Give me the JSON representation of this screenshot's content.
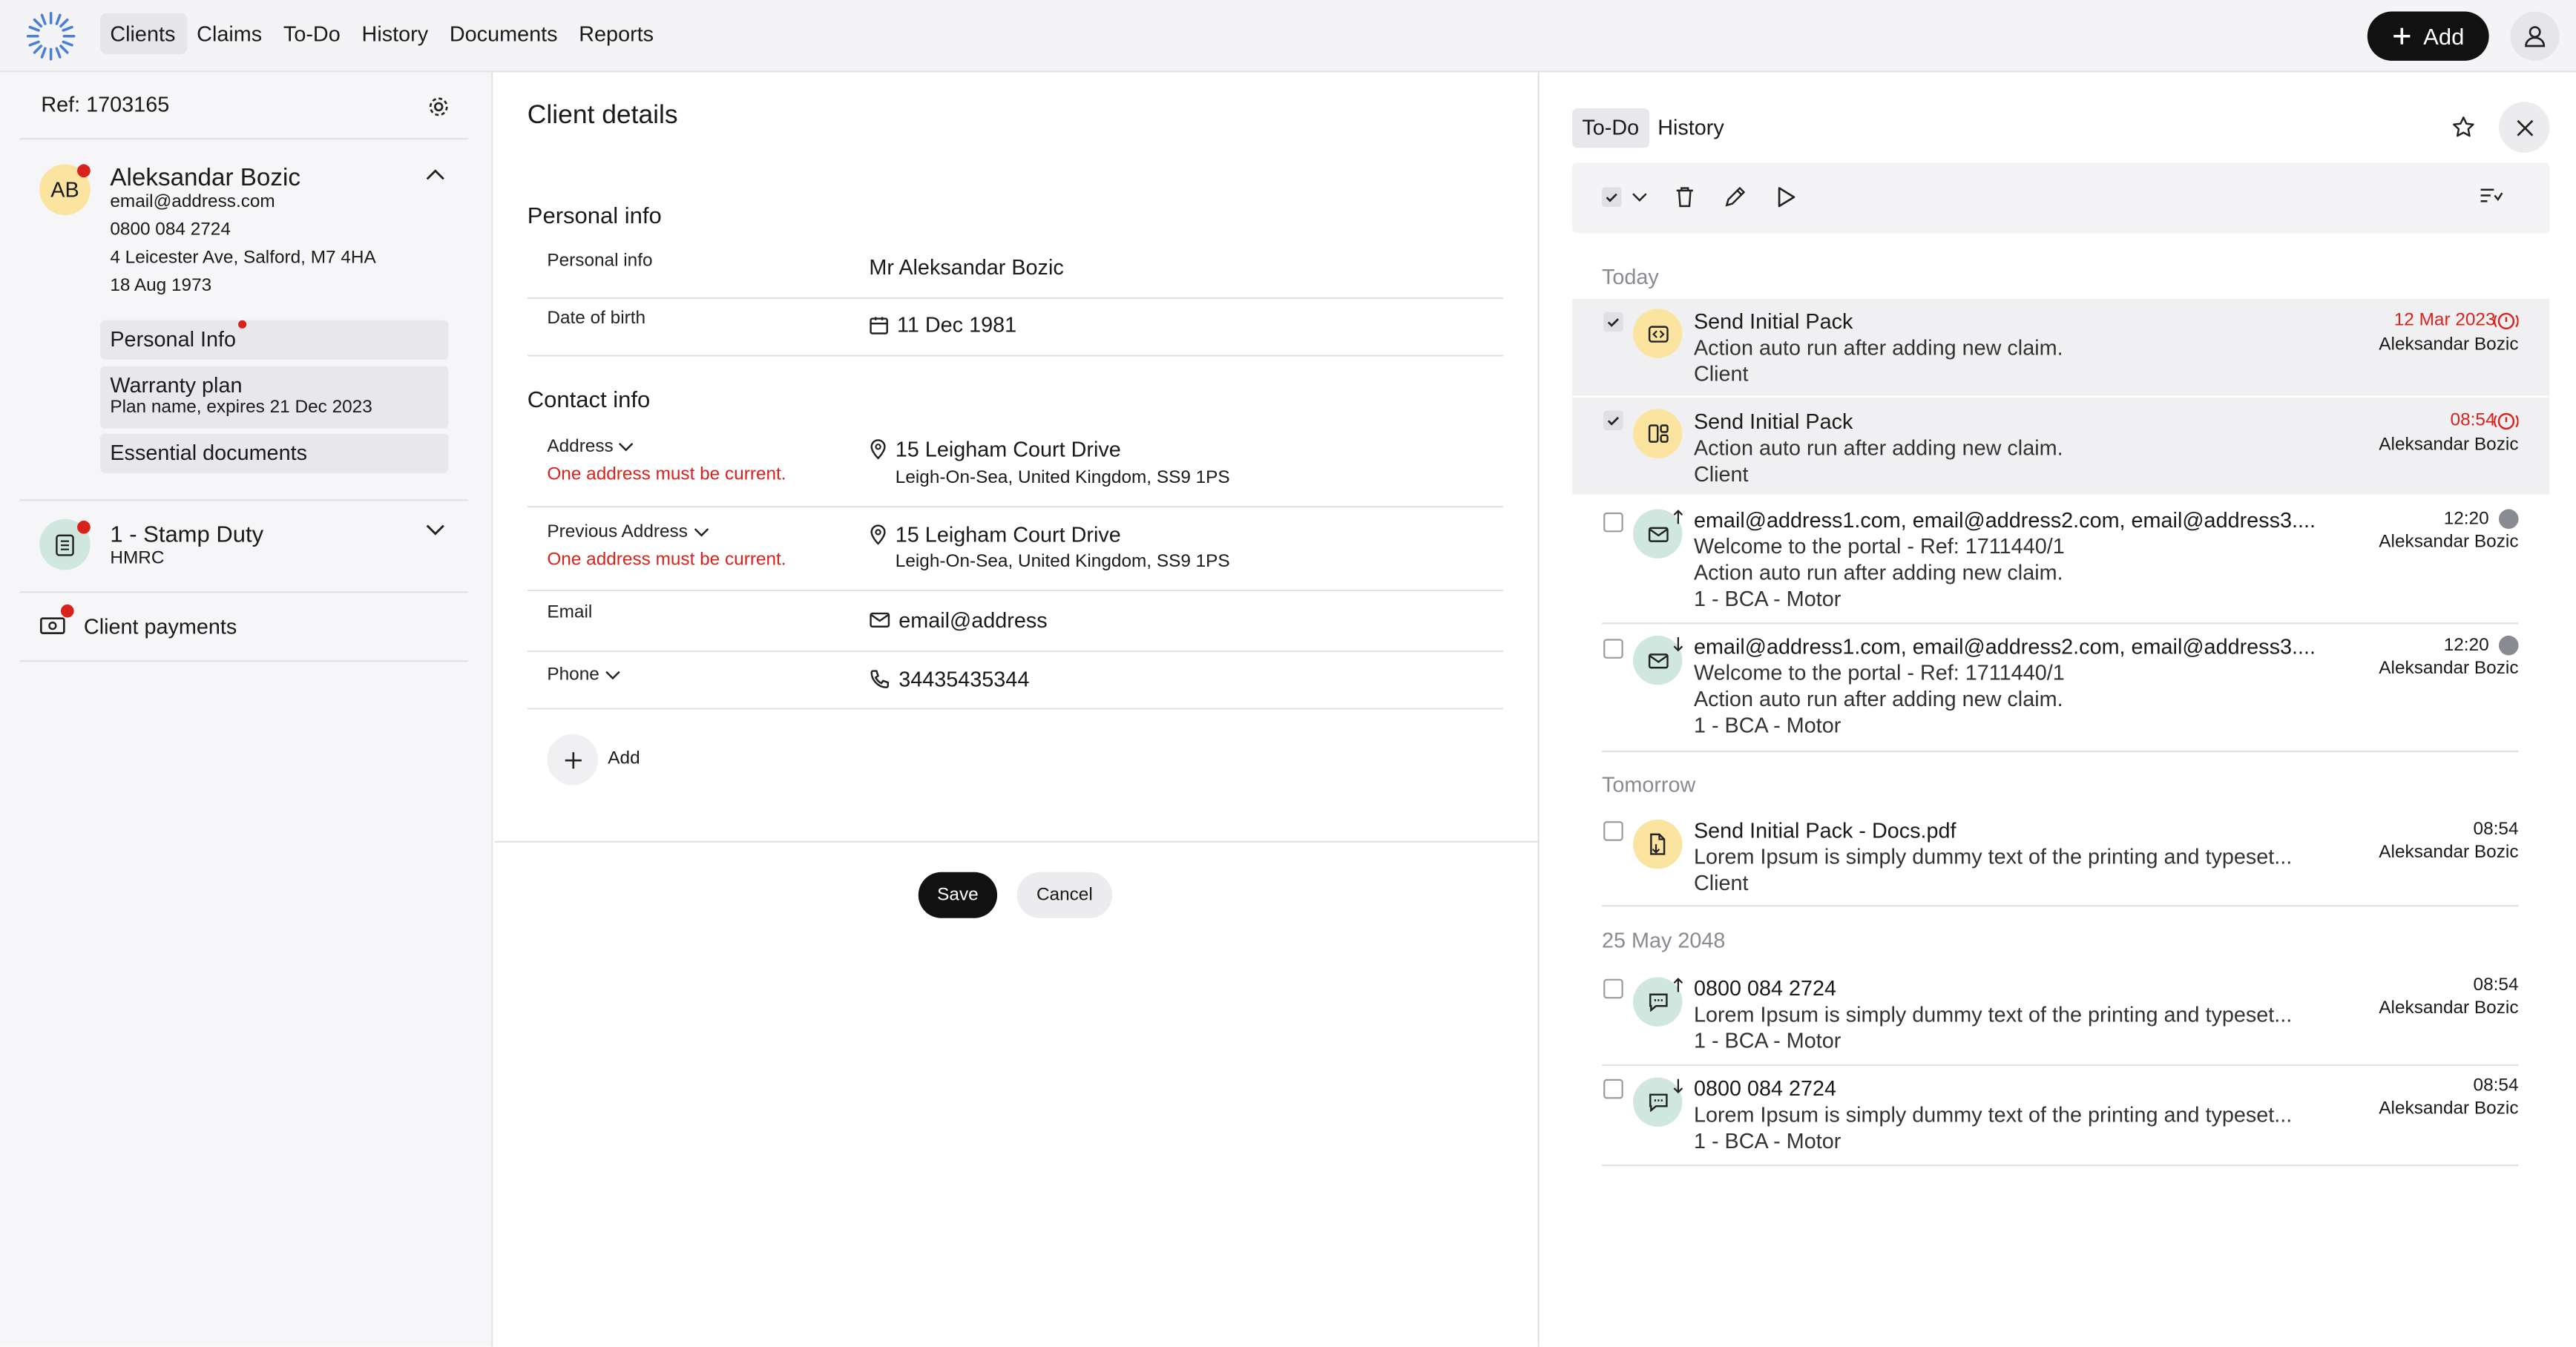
{
  "nav": {
    "items": [
      "Clients",
      "Claims",
      "To-Do",
      "History",
      "Documents",
      "Reports"
    ],
    "add_label": "Add"
  },
  "sidebar": {
    "ref": "Ref: 1703165",
    "client": {
      "initials": "AB",
      "name": "Aleksandar Bozic",
      "email": "email@address.com",
      "phone": "0800 084 2724",
      "address": "4 Leicester Ave, Salford, M7 4HA",
      "dob": "18 Aug 1973"
    },
    "chips": {
      "personal_info": "Personal Info",
      "warranty_title": "Warranty plan",
      "warranty_sub": "Plan name, expires 21 Dec 2023",
      "essential_docs": "Essential documents"
    },
    "claim": {
      "title": "1 - Stamp Duty",
      "sub": "HMRC"
    },
    "payments": "Client payments"
  },
  "details": {
    "title": "Client details",
    "personal_heading": "Personal info",
    "personal_label": "Personal info",
    "personal_value": "Mr Aleksandar Bozic",
    "dob_label": "Date of birth",
    "dob_value": "11 Dec 1981",
    "contact_heading": "Contact info",
    "address_label": "Address",
    "address_error": "One address must be current.",
    "address_line1": "15 Leigham Court Drive",
    "address_line2": "Leigh-On-Sea, United Kingdom, SS9 1PS",
    "prev_label": "Previous Address",
    "prev_error": "One address must be current.",
    "prev_line1": "15 Leigham Court Drive",
    "prev_line2": "Leigh-On-Sea, United Kingdom, SS9 1PS",
    "email_label": "Email",
    "email_value": "email@address",
    "phone_label": "Phone",
    "phone_value": "34435435344",
    "add_label": "Add",
    "save": "Save",
    "cancel": "Cancel"
  },
  "panel": {
    "tabs": [
      "To-Do",
      "History"
    ],
    "sections": [
      "Today",
      "Tomorrow",
      "25 May 2048"
    ],
    "items": [
      {
        "title": "Send Initial Pack",
        "line2": "Action auto run after adding new claim.",
        "line3": "Client",
        "time": "12 Mar 2023",
        "person": "Aleksandar Bozic"
      },
      {
        "title": "Send Initial Pack",
        "line2": "Action auto run after adding new claim.",
        "line3": "Client",
        "time": "08:54",
        "person": "Aleksandar Bozic"
      },
      {
        "title": "email@address1.com, email@address2.com, email@address3....",
        "line2": "Welcome to the portal - Ref: 1711440/1",
        "line3": "Action auto run after adding new claim.",
        "line4": "1 - BCA - Motor",
        "time": "12:20",
        "person": "Aleksandar Bozic"
      },
      {
        "title": "email@address1.com, email@address2.com, email@address3....",
        "line2": "Welcome to the portal - Ref: 1711440/1",
        "line3": "Action auto run after adding new claim.",
        "line4": "1 - BCA - Motor",
        "time": "12:20",
        "person": "Aleksandar Bozic"
      },
      {
        "title": "Send Initial Pack - Docs.pdf",
        "line2": "Lorem Ipsum is simply dummy text of the printing and typeset...",
        "line3": "Client",
        "time": "08:54",
        "person": "Aleksandar Bozic"
      },
      {
        "title": "0800 084 2724",
        "line2": "Lorem Ipsum is simply dummy text of the printing and typeset...",
        "line3": "1 - BCA - Motor",
        "time": "08:54",
        "person": "Aleksandar Bozic"
      },
      {
        "title": "0800 084 2724",
        "line2": "Lorem Ipsum is simply dummy text of the printing and typeset...",
        "line3": "1 - BCA - Motor",
        "time": "08:54",
        "person": "Aleksandar Bozic"
      }
    ]
  },
  "colors": {
    "accent": "#111111",
    "error": "#d8231c",
    "yellow": "#fbe3a0",
    "mint": "#cfe7df",
    "selected_row": "#f0f0f2"
  }
}
